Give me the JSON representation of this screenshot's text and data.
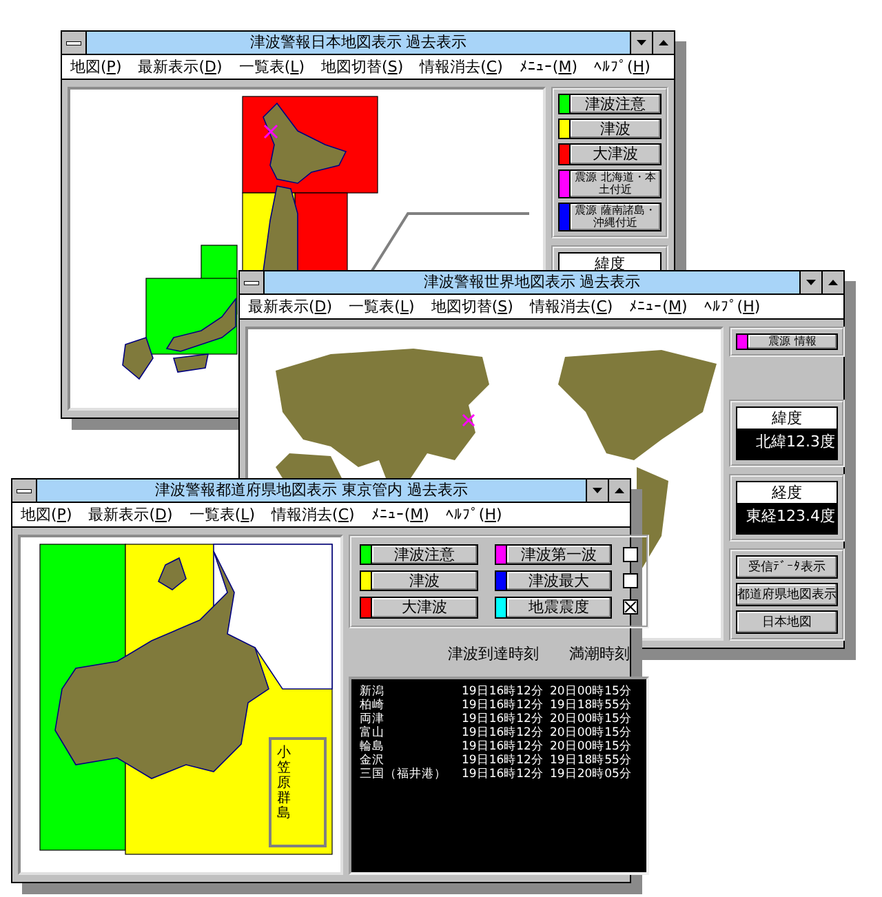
{
  "japan_window": {
    "title": "津波警報日本地図表示 過去表示",
    "menu": [
      "地図(P)",
      "最新表示(D)",
      "一覧表(L)",
      "地図切替(S)",
      "情報消去(C)",
      "ﾒﾆｭｰ(M)",
      "ﾍﾙﾌﾟ(H)"
    ],
    "legend": [
      {
        "label": "津波注意",
        "color": "#00ff00"
      },
      {
        "label": "津波",
        "color": "#ffff00"
      },
      {
        "label": "大津波",
        "color": "#ff0000"
      },
      {
        "label": "震源 北海道・本土付近",
        "color": "#ff00ff"
      },
      {
        "label": "震源 薩南諸島・沖縄付近",
        "color": "#0000ff"
      }
    ],
    "latitude": {
      "label": "緯度"
    }
  },
  "world_window": {
    "title": "津波警報世界地図表示 過去表示",
    "menu": [
      "最新表示(D)",
      "一覧表(L)",
      "地図切替(S)",
      "情報消去(C)",
      "ﾒﾆｭｰ(M)",
      "ﾍﾙﾌﾟ(H)"
    ],
    "legend": [
      {
        "label": "震源 情報",
        "color": "#ff00ff"
      }
    ],
    "readouts": [
      {
        "label": "緯度",
        "value": "北緯12.3度"
      },
      {
        "label": "経度",
        "value": "東経123.4度"
      }
    ],
    "buttons": [
      "受信ﾃﾞｰﾀ表示",
      "都道府県地図表示",
      "日本地図"
    ]
  },
  "prefecture_window": {
    "title": "津波警報都道府県地図表示 東京管内 過去表示",
    "menu": [
      "地図(P)",
      "最新表示(D)",
      "一覧表(L)",
      "情報消去(C)",
      "ﾒﾆｭｰ(M)",
      "ﾍﾙﾌﾟ(H)"
    ],
    "legend": [
      {
        "label": "津波注意",
        "color": "#00ff00"
      },
      {
        "label": "津波",
        "color": "#ffff00"
      },
      {
        "label": "大津波",
        "color": "#ff0000"
      },
      {
        "label": "津波第一波",
        "color": "#ff00ff",
        "checked": false
      },
      {
        "label": "津波最大",
        "color": "#0000ff",
        "checked": false
      },
      {
        "label": "地震震度",
        "color": "#00ffff",
        "checked": true
      }
    ],
    "columns": [
      "津波到達時刻",
      "満潮時刻"
    ],
    "rows": [
      {
        "place": "新潟",
        "arrival": "19日16時12分",
        "high_tide": "20日00時15分"
      },
      {
        "place": "柏崎",
        "arrival": "19日16時12分",
        "high_tide": "19日18時55分"
      },
      {
        "place": "両津",
        "arrival": "19日16時12分",
        "high_tide": "20日00時15分"
      },
      {
        "place": "富山",
        "arrival": "19日16時12分",
        "high_tide": "20日00時15分"
      },
      {
        "place": "輪島",
        "arrival": "19日16時12分",
        "high_tide": "20日00時15分"
      },
      {
        "place": "金沢",
        "arrival": "19日16時12分",
        "high_tide": "19日18時55分"
      },
      {
        "place": "三国（福井港）",
        "arrival": "19日16時12分",
        "high_tide": "19日20時05分"
      }
    ],
    "island_label": "小笠原群島"
  }
}
